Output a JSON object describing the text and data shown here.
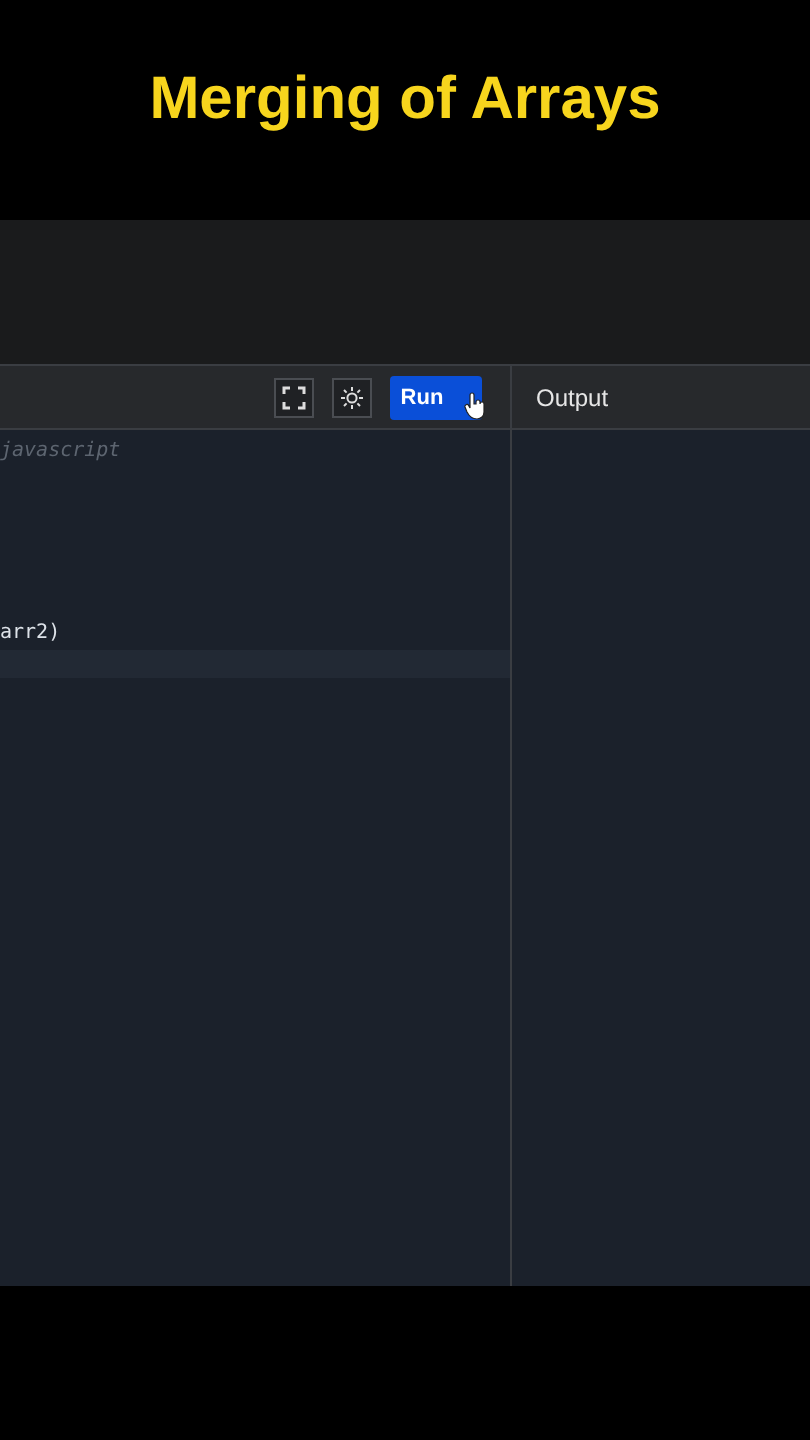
{
  "title": "Merging of Arrays",
  "toolbar": {
    "run_button": "Run"
  },
  "output_panel": {
    "title": "Output"
  },
  "editor": {
    "lines": [
      {
        "text": "javascript",
        "kind": "comment"
      },
      {
        "text": "arr2)",
        "kind": "code"
      }
    ]
  }
}
